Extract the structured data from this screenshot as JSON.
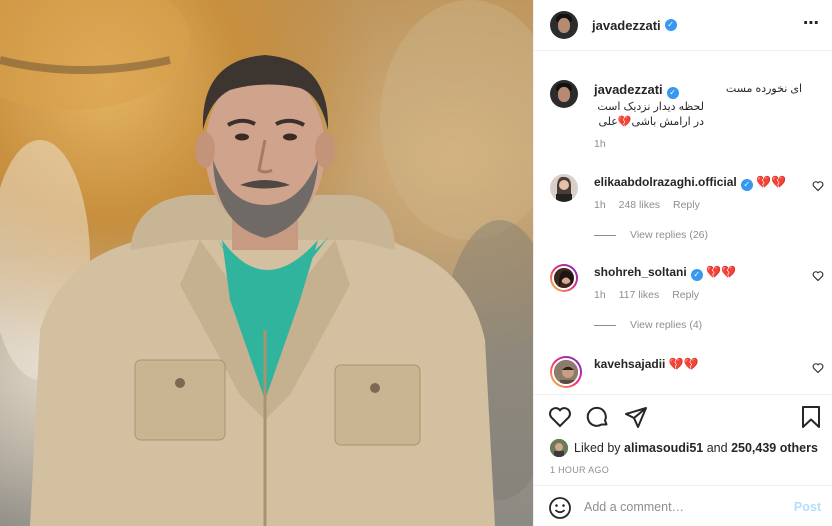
{
  "post": {
    "author": "javadezzati",
    "verified": true,
    "more_icon": "more-horizontal-icon",
    "caption": {
      "username": "javadezzati",
      "lines": [
        "ای نخورده مست",
        "لحظه دیدار نزدیک است",
        "در ارامش باشی💔علی"
      ],
      "time": "1h"
    },
    "comments": [
      {
        "username": "elikaabdolrazaghi.official",
        "verified": true,
        "text": "💔💔",
        "time": "1h",
        "likes": "248 likes",
        "reply": "Reply",
        "view_replies": "View replies (26)",
        "story_ring": false
      },
      {
        "username": "shohreh_soltani",
        "verified": true,
        "text": "💔💔",
        "time": "1h",
        "likes": "117 likes",
        "reply": "Reply",
        "view_replies": "View replies (4)",
        "story_ring": true
      },
      {
        "username": "kavehsajadii",
        "verified": false,
        "text": "💔💔",
        "story_ring": true
      }
    ],
    "liked_by": {
      "prefix": "Liked by",
      "user": "alimasoudi51",
      "and": "and",
      "others": "250,439 others"
    },
    "time_ago": "1 HOUR AGO",
    "add_comment": {
      "placeholder": "Add a comment…",
      "post_label": "Post"
    },
    "icons": [
      "heart-icon",
      "comment-icon",
      "share-icon",
      "bookmark-icon",
      "emoji-icon"
    ],
    "colors": {
      "verified": "#3897f0",
      "muted": "#8e8e8e",
      "post_disabled": "#b2dffc"
    }
  }
}
